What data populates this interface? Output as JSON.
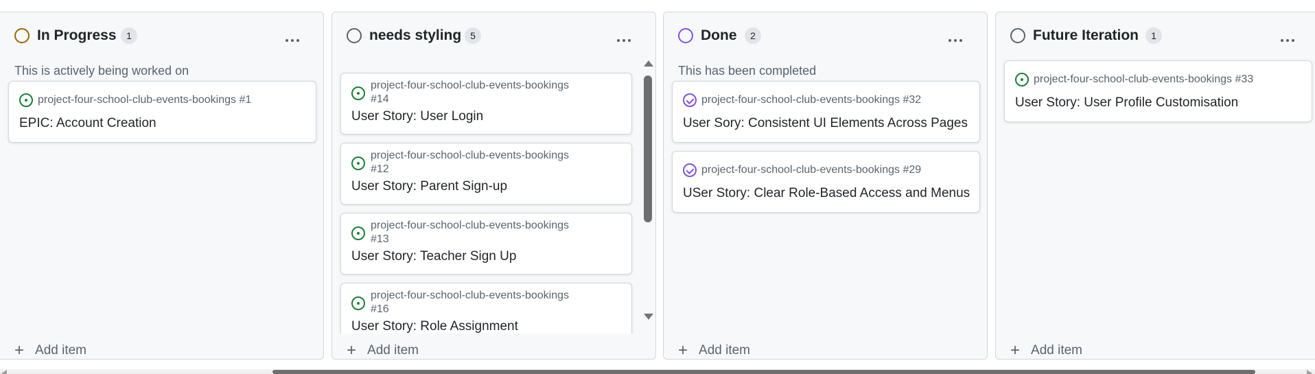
{
  "columns": [
    {
      "title": "In Progress",
      "count": "1",
      "description": "This is actively being worked on",
      "status_color": "#9a6700",
      "add_label": "Add item",
      "cards": [
        {
          "ref": "project-four-school-club-events-bookings #1",
          "title": "EPIC: Account Creation",
          "state": "open"
        }
      ]
    },
    {
      "title": "needs styling",
      "count": "5",
      "description": "",
      "status_color": "#59636e",
      "add_label": "Add item",
      "cards": [
        {
          "ref_line1": "project-four-school-club-events-bookings",
          "ref_line2": "#14",
          "title": "User Story: User Login",
          "state": "open"
        },
        {
          "ref_line1": "project-four-school-club-events-bookings",
          "ref_line2": "#12",
          "title": "User Story: Parent Sign-up",
          "state": "open"
        },
        {
          "ref_line1": "project-four-school-club-events-bookings",
          "ref_line2": "#13",
          "title": "User Story: Teacher Sign Up",
          "state": "open"
        },
        {
          "ref_line1": "project-four-school-club-events-bookings",
          "ref_line2": "#16",
          "title": "User Story: Role Assignment",
          "state": "open"
        }
      ]
    },
    {
      "title": "Done",
      "count": "2",
      "description": "This has been completed",
      "status_color": "#8250df",
      "add_label": "Add item",
      "cards": [
        {
          "ref": "project-four-school-club-events-bookings #32",
          "title": "User Sory: Consistent UI Elements Across Pages",
          "state": "closed"
        },
        {
          "ref": "project-four-school-club-events-bookings #29",
          "title": "USer Story: Clear Role-Based Access and Menus",
          "state": "closed"
        }
      ]
    },
    {
      "title": "Future Iteration",
      "count": "1",
      "description": "",
      "status_color": "#59636e",
      "add_label": "Add item",
      "cards": [
        {
          "ref": "project-four-school-club-events-bookings #33",
          "title": "User Story: User Profile Customisation",
          "state": "open"
        }
      ]
    }
  ]
}
